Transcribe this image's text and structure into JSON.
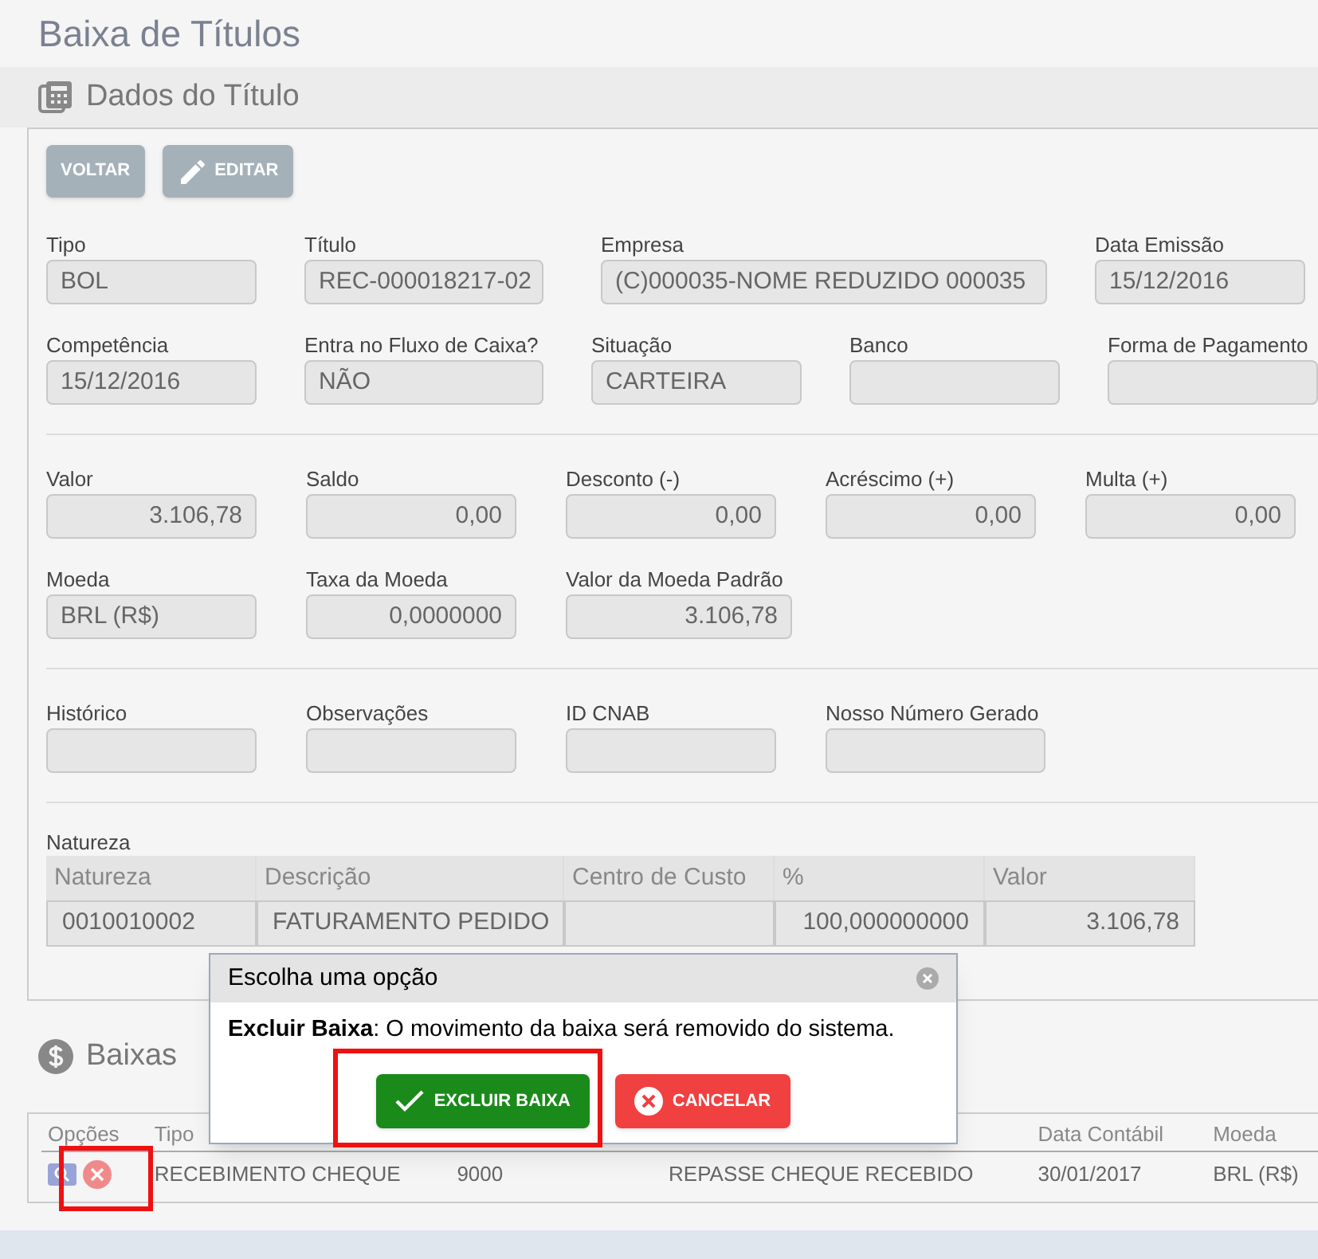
{
  "page": {
    "title": "Baixa de Títulos"
  },
  "titulo_panel": {
    "title": "Dados do Título",
    "buttons": [
      {
        "label": "VOLTAR",
        "kind": "plain"
      },
      {
        "label": "EDITAR",
        "kind": "edit"
      }
    ],
    "groups": [
      [
        [
          {
            "label": "Tipo",
            "value": "BOL"
          },
          {
            "label": "Título",
            "value": "REC-000018217-02"
          },
          {
            "label": "Empresa",
            "value": "(C)000035-NOME REDUZIDO 000035"
          },
          {
            "label": "Data Emissão",
            "value": "15/12/2016"
          }
        ],
        [
          {
            "label": "Competência",
            "value": "15/12/2016"
          },
          {
            "label": "Entra no Fluxo de Caixa?",
            "value": "NÃO"
          },
          {
            "label": "Situação",
            "value": "CARTEIRA"
          },
          {
            "label": "Banco"
          },
          {
            "label": "Forma de Pagamento"
          }
        ]
      ],
      [
        [
          {
            "label": "Valor",
            "value": "3.106,78"
          },
          {
            "label": "Saldo",
            "value": "0,00"
          },
          {
            "label": "Desconto (-)",
            "value": "0,00"
          },
          {
            "label": "Acréscimo (+)",
            "value": "0,00"
          },
          {
            "label": "Multa (+)",
            "value": "0,00"
          }
        ],
        [
          {
            "label": "Moeda",
            "value": "BRL (R$)"
          },
          {
            "label": "Taxa da Moeda",
            "value": "0,0000000"
          },
          {
            "label": "Valor da Moeda Padrão",
            "value": "3.106,78"
          }
        ]
      ],
      [
        [
          {
            "label": "Histórico"
          },
          {
            "label": "Observações"
          },
          {
            "label": "ID CNAB"
          },
          {
            "label": "Nosso Número Gerado"
          }
        ]
      ]
    ],
    "natureza": {
      "title": "Natureza",
      "columns": [
        "Natureza",
        "Descrição",
        "Centro de Custo",
        "%",
        "Valor"
      ],
      "rows": [
        {
          "natureza": "0010010002",
          "descricao": "FATURAMENTO PEDIDO",
          "percent": "100,000000000",
          "valor": "3.106,78"
        }
      ]
    }
  },
  "baixas_panel": {
    "title": "Baixas",
    "columns": {
      "opcoes": "Opções",
      "tipo": "Tipo",
      "data_contabil": "Data Contábil",
      "moeda": "Moeda"
    },
    "rows": [
      {
        "tipo": "RECEBIMENTO CHEQUE",
        "column_3": "9000",
        "column_4": "REPASSE CHEQUE RECEBIDO",
        "data_contabil": "30/01/2017",
        "moeda": "BRL (R$)"
      }
    ]
  },
  "dialog": {
    "title": "Escolha uma opção",
    "message": "**Excluir Baixa**: O movimento da baixa será removido do sistema.",
    "buttons": [
      {
        "label": "EXCLUIR BAIXA",
        "kind": "confirm"
      },
      {
        "label": "CANCELAR",
        "kind": "cancel"
      }
    ]
  }
}
